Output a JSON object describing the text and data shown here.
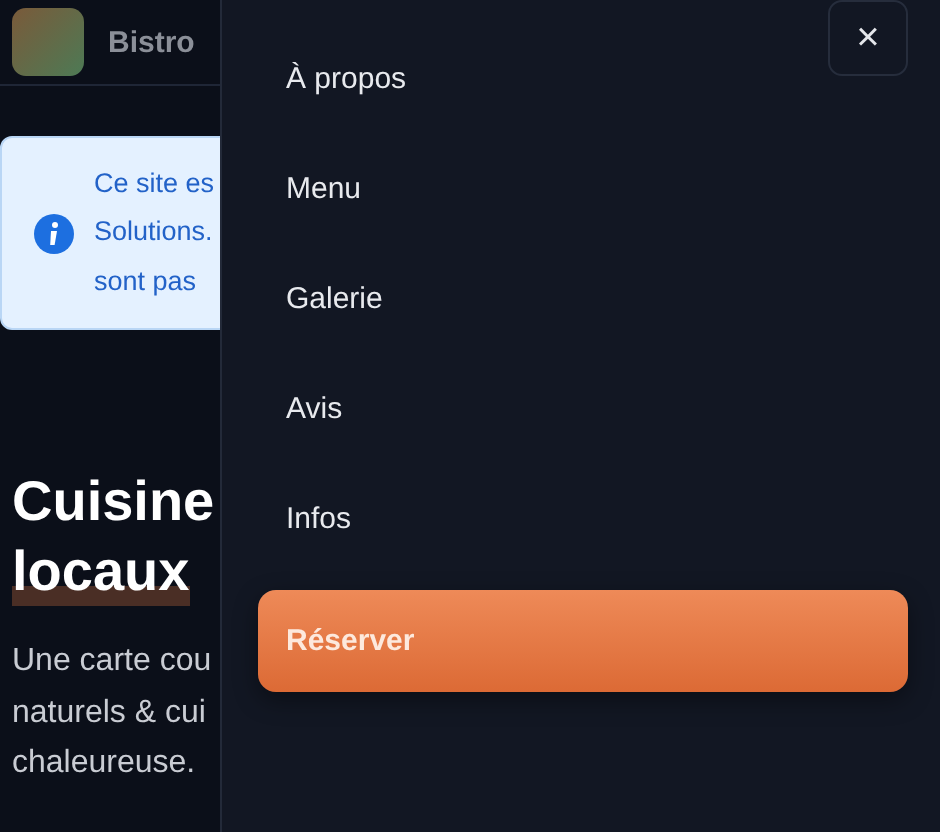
{
  "header": {
    "title": "Bistro"
  },
  "notice": {
    "lines": [
      "Ce site es",
      "Solutions.",
      "sont pas"
    ]
  },
  "hero": {
    "title_lines": [
      "Cuisine",
      "locaux"
    ],
    "text_lines": [
      "Une carte cou",
      "naturels & cui",
      "chaleureuse."
    ]
  },
  "drawer": {
    "close": "×",
    "links": [
      {
        "label": "À propos",
        "kind": "link"
      },
      {
        "label": "Menu",
        "kind": "link"
      },
      {
        "label": "Galerie",
        "kind": "link"
      },
      {
        "label": "Avis",
        "kind": "link"
      },
      {
        "label": "Infos",
        "kind": "link"
      },
      {
        "label": "Réserver",
        "kind": "cta"
      }
    ]
  }
}
